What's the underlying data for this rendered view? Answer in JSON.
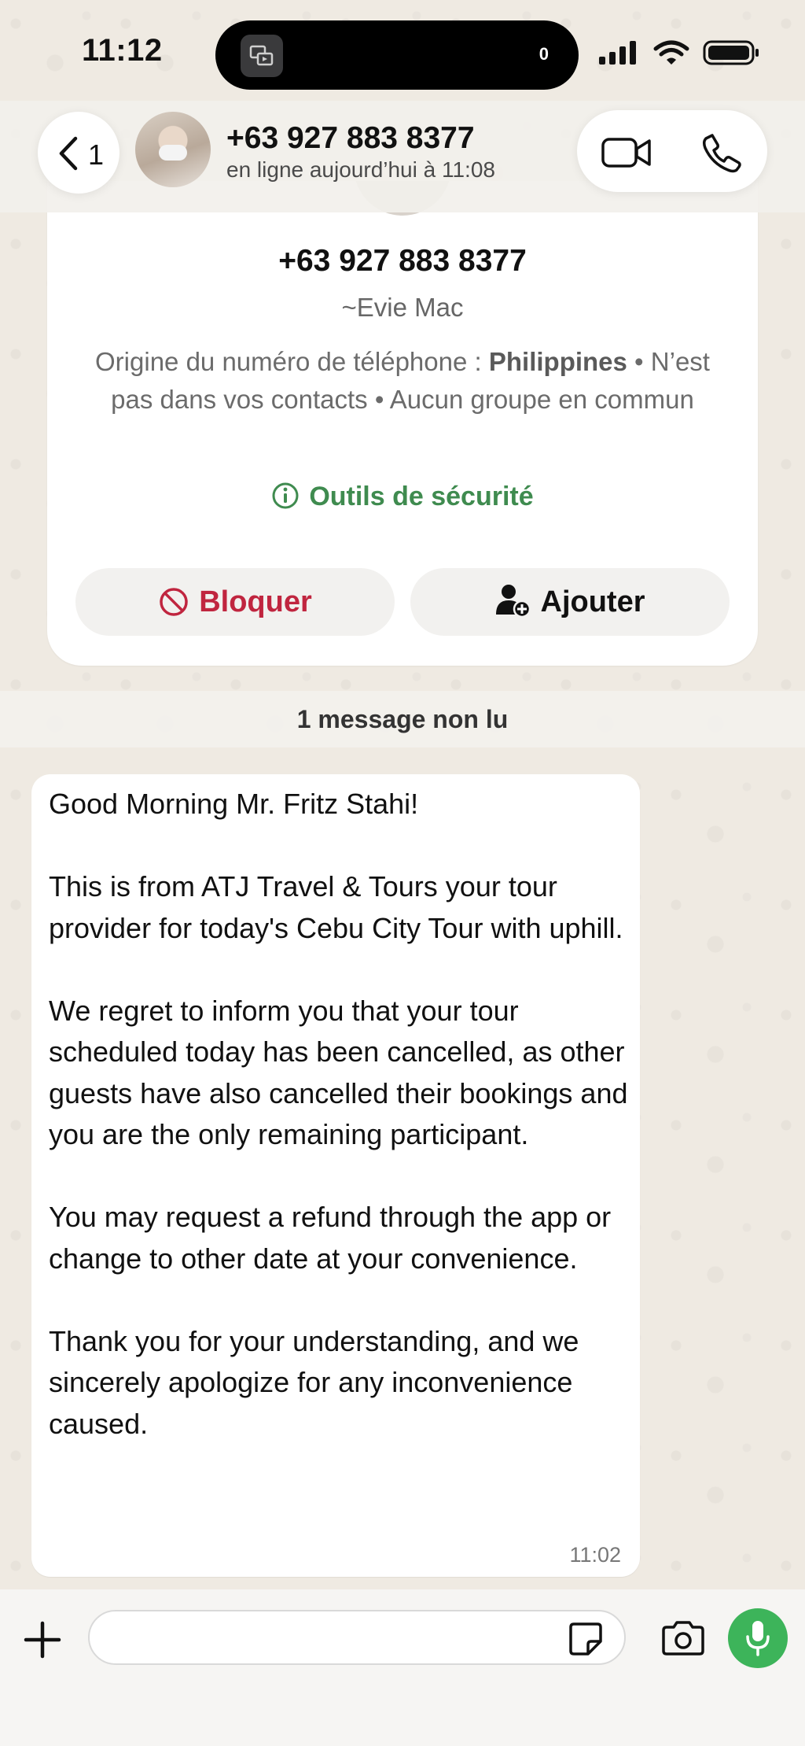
{
  "status_bar": {
    "time": "11:12",
    "island_count": "0"
  },
  "header": {
    "back_count": "1",
    "contact_name": "+63 927 883 8377",
    "presence": "en ligne aujourd’hui à 11:08"
  },
  "contact_card": {
    "phone": "+63 927 883 8377",
    "alias": "~Evie Mac",
    "origin_prefix": "Origine du numéro de téléphone : ",
    "origin_country": "Philippines",
    "origin_suffix": " • N’est pas dans vos contacts • Aucun groupe en commun",
    "security_tools": "Outils de sécurité",
    "block_label": "Bloquer",
    "add_label": "Ajouter"
  },
  "unread_banner": "1 message non lu",
  "message": {
    "text": "Good Morning Mr. Fritz Stahi!\n\nThis is from ATJ Travel & Tours your tour provider for today's Cebu City Tour with uphill.\n\nWe regret to inform you that your tour scheduled today has been cancelled, as other guests have also cancelled their bookings and you are the only remaining participant.\n\nYou may request a refund through the app or change to other date at your convenience.\n\nThank you for your understanding, and we sincerely apologize for any inconvenience caused.",
    "time": "11:02"
  },
  "composer": {
    "input_value": "",
    "icons": [
      "plus-icon",
      "sticker-icon",
      "camera-icon",
      "microphone-icon"
    ]
  },
  "colors": {
    "accent_green": "#3db45a",
    "security_green": "#3f8b4f",
    "block_red": "#c0253f",
    "chat_background": "#efeae2"
  }
}
